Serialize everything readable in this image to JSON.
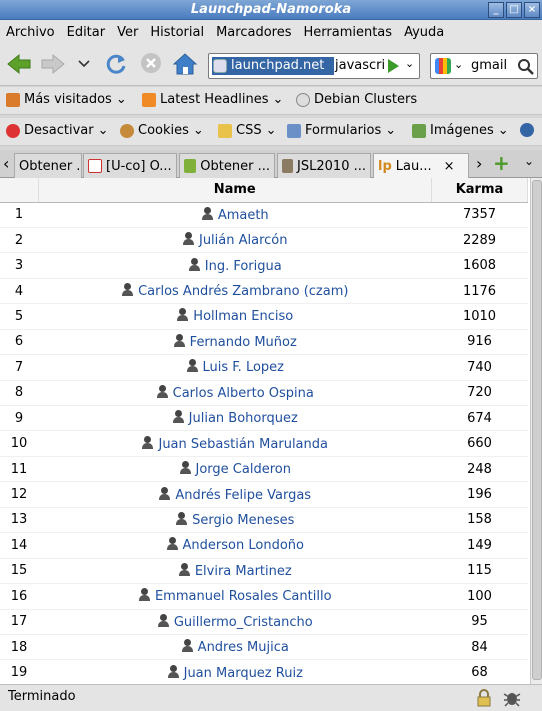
{
  "window": {
    "title": "Launchpad-Namoroka"
  },
  "menu": [
    "Archivo",
    "Editar",
    "Ver",
    "Historial",
    "Marcadores",
    "Herramientas",
    "Ayuda"
  ],
  "url": {
    "host": "launchpad.net",
    "rest": "javascri"
  },
  "search": {
    "value": "gmail"
  },
  "bookmarks": [
    {
      "label": "Más visitados",
      "icon": "star-icon"
    },
    {
      "label": "Latest Headlines",
      "icon": "rss-icon"
    },
    {
      "label": "Debian Clusters",
      "icon": "web-icon"
    }
  ],
  "devtools": [
    "Desactivar",
    "Cookies",
    "CSS",
    "Formularios",
    "Imágenes"
  ],
  "tabs": [
    "Obtener ...",
    "[U-co] O...",
    "Obtener ...",
    "JSL2010 ...",
    "Lau..."
  ],
  "table": {
    "headers": {
      "name": "Name",
      "karma": "Karma"
    },
    "rows": [
      {
        "rank": "1",
        "name": "Amaeth",
        "karma": "7357"
      },
      {
        "rank": "2",
        "name": "Julián Alarcón",
        "karma": "2289"
      },
      {
        "rank": "3",
        "name": "Ing. Forigua",
        "karma": "1608"
      },
      {
        "rank": "4",
        "name": "Carlos Andrés Zambrano (czam)",
        "karma": "1176"
      },
      {
        "rank": "5",
        "name": "Hollman Enciso",
        "karma": "1010"
      },
      {
        "rank": "6",
        "name": "Fernando Muñoz",
        "karma": "916"
      },
      {
        "rank": "7",
        "name": "Luis F. Lopez",
        "karma": "740"
      },
      {
        "rank": "8",
        "name": "Carlos Alberto Ospina",
        "karma": "720"
      },
      {
        "rank": "9",
        "name": "Julian Bohorquez",
        "karma": "674"
      },
      {
        "rank": "10",
        "name": "Juan Sebastián Marulanda",
        "karma": "660"
      },
      {
        "rank": "11",
        "name": "Jorge Calderon",
        "karma": "248"
      },
      {
        "rank": "12",
        "name": "Andrés Felipe Vargas",
        "karma": "196"
      },
      {
        "rank": "13",
        "name": "Sergio Meneses",
        "karma": "158"
      },
      {
        "rank": "14",
        "name": "Anderson Londoño",
        "karma": "149"
      },
      {
        "rank": "15",
        "name": "Elvira Martinez",
        "karma": "115"
      },
      {
        "rank": "16",
        "name": "Emmanuel Rosales Cantillo",
        "karma": "100"
      },
      {
        "rank": "17",
        "name": "Guillermo_Cristancho",
        "karma": "95"
      },
      {
        "rank": "18",
        "name": "Andres Mujica",
        "karma": "84"
      },
      {
        "rank": "19",
        "name": "Juan Marquez Ruiz",
        "karma": "68"
      }
    ]
  },
  "status": {
    "text": "Terminado"
  },
  "colors": {
    "link": "#1f4f9e",
    "titlebar": "#4a7cbf"
  }
}
